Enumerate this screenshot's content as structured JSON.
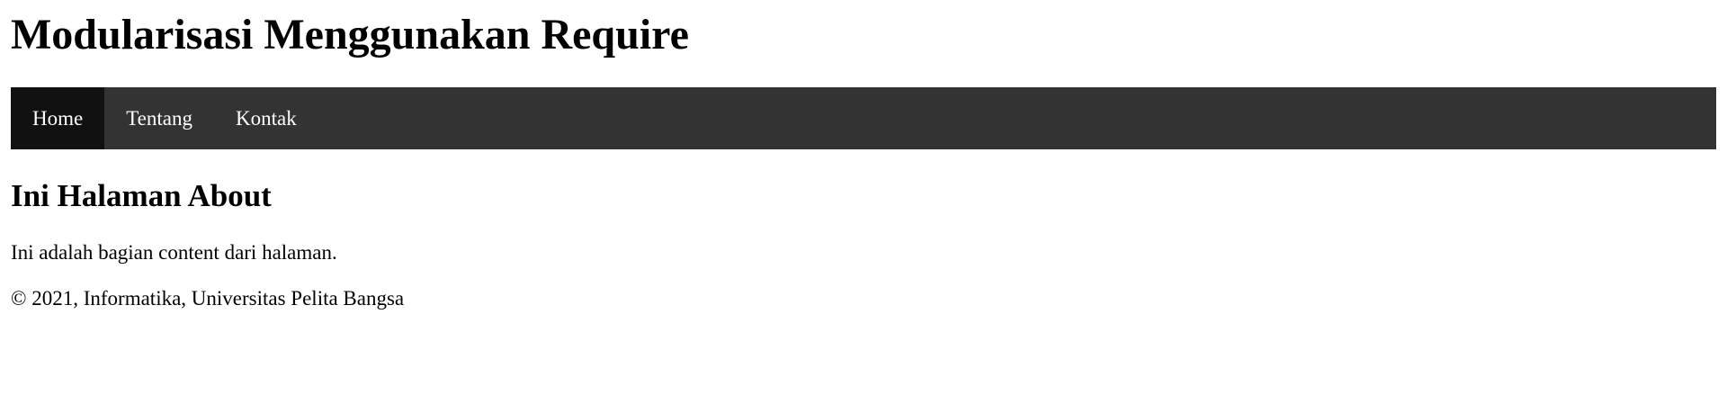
{
  "header": {
    "title": "Modularisasi Menggunakan Require"
  },
  "nav": {
    "items": [
      {
        "label": "Home",
        "active": true
      },
      {
        "label": "Tentang",
        "active": false
      },
      {
        "label": "Kontak",
        "active": false
      }
    ]
  },
  "main": {
    "heading": "Ini Halaman About",
    "paragraph": "Ini adalah bagian content dari halaman."
  },
  "footer": {
    "text": "© 2021, Informatika, Universitas Pelita Bangsa"
  },
  "colors": {
    "navbar_bg": "#333333",
    "nav_active_bg": "#111111",
    "nav_text": "#ffffff",
    "page_bg": "#ffffff",
    "text": "#000000"
  }
}
